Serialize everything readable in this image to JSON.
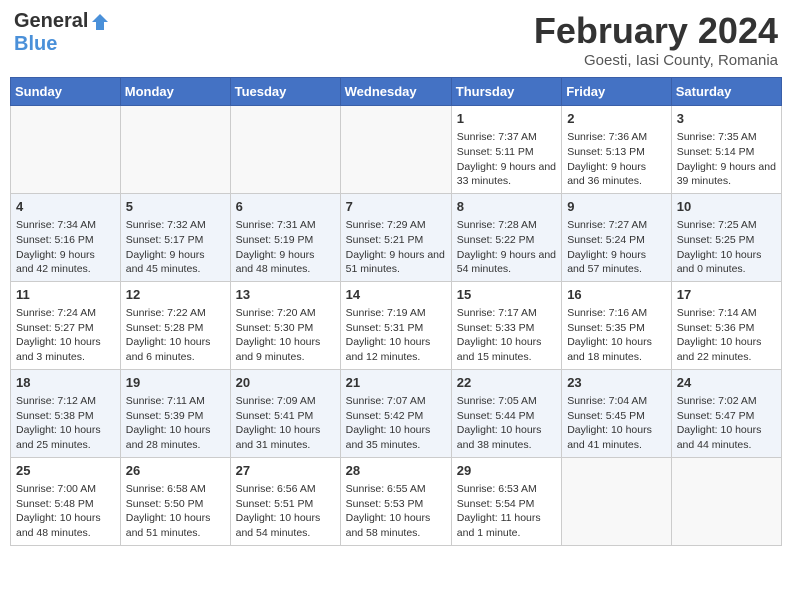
{
  "header": {
    "logo_general": "General",
    "logo_blue": "Blue",
    "month_title": "February 2024",
    "location": "Goesti, Iasi County, Romania"
  },
  "days_of_week": [
    "Sunday",
    "Monday",
    "Tuesday",
    "Wednesday",
    "Thursday",
    "Friday",
    "Saturday"
  ],
  "weeks": [
    {
      "days": [
        {
          "number": "",
          "info": ""
        },
        {
          "number": "",
          "info": ""
        },
        {
          "number": "",
          "info": ""
        },
        {
          "number": "",
          "info": ""
        },
        {
          "number": "1",
          "info": "Sunrise: 7:37 AM\nSunset: 5:11 PM\nDaylight: 9 hours and 33 minutes."
        },
        {
          "number": "2",
          "info": "Sunrise: 7:36 AM\nSunset: 5:13 PM\nDaylight: 9 hours and 36 minutes."
        },
        {
          "number": "3",
          "info": "Sunrise: 7:35 AM\nSunset: 5:14 PM\nDaylight: 9 hours and 39 minutes."
        }
      ]
    },
    {
      "days": [
        {
          "number": "4",
          "info": "Sunrise: 7:34 AM\nSunset: 5:16 PM\nDaylight: 9 hours and 42 minutes."
        },
        {
          "number": "5",
          "info": "Sunrise: 7:32 AM\nSunset: 5:17 PM\nDaylight: 9 hours and 45 minutes."
        },
        {
          "number": "6",
          "info": "Sunrise: 7:31 AM\nSunset: 5:19 PM\nDaylight: 9 hours and 48 minutes."
        },
        {
          "number": "7",
          "info": "Sunrise: 7:29 AM\nSunset: 5:21 PM\nDaylight: 9 hours and 51 minutes."
        },
        {
          "number": "8",
          "info": "Sunrise: 7:28 AM\nSunset: 5:22 PM\nDaylight: 9 hours and 54 minutes."
        },
        {
          "number": "9",
          "info": "Sunrise: 7:27 AM\nSunset: 5:24 PM\nDaylight: 9 hours and 57 minutes."
        },
        {
          "number": "10",
          "info": "Sunrise: 7:25 AM\nSunset: 5:25 PM\nDaylight: 10 hours and 0 minutes."
        }
      ]
    },
    {
      "days": [
        {
          "number": "11",
          "info": "Sunrise: 7:24 AM\nSunset: 5:27 PM\nDaylight: 10 hours and 3 minutes."
        },
        {
          "number": "12",
          "info": "Sunrise: 7:22 AM\nSunset: 5:28 PM\nDaylight: 10 hours and 6 minutes."
        },
        {
          "number": "13",
          "info": "Sunrise: 7:20 AM\nSunset: 5:30 PM\nDaylight: 10 hours and 9 minutes."
        },
        {
          "number": "14",
          "info": "Sunrise: 7:19 AM\nSunset: 5:31 PM\nDaylight: 10 hours and 12 minutes."
        },
        {
          "number": "15",
          "info": "Sunrise: 7:17 AM\nSunset: 5:33 PM\nDaylight: 10 hours and 15 minutes."
        },
        {
          "number": "16",
          "info": "Sunrise: 7:16 AM\nSunset: 5:35 PM\nDaylight: 10 hours and 18 minutes."
        },
        {
          "number": "17",
          "info": "Sunrise: 7:14 AM\nSunset: 5:36 PM\nDaylight: 10 hours and 22 minutes."
        }
      ]
    },
    {
      "days": [
        {
          "number": "18",
          "info": "Sunrise: 7:12 AM\nSunset: 5:38 PM\nDaylight: 10 hours and 25 minutes."
        },
        {
          "number": "19",
          "info": "Sunrise: 7:11 AM\nSunset: 5:39 PM\nDaylight: 10 hours and 28 minutes."
        },
        {
          "number": "20",
          "info": "Sunrise: 7:09 AM\nSunset: 5:41 PM\nDaylight: 10 hours and 31 minutes."
        },
        {
          "number": "21",
          "info": "Sunrise: 7:07 AM\nSunset: 5:42 PM\nDaylight: 10 hours and 35 minutes."
        },
        {
          "number": "22",
          "info": "Sunrise: 7:05 AM\nSunset: 5:44 PM\nDaylight: 10 hours and 38 minutes."
        },
        {
          "number": "23",
          "info": "Sunrise: 7:04 AM\nSunset: 5:45 PM\nDaylight: 10 hours and 41 minutes."
        },
        {
          "number": "24",
          "info": "Sunrise: 7:02 AM\nSunset: 5:47 PM\nDaylight: 10 hours and 44 minutes."
        }
      ]
    },
    {
      "days": [
        {
          "number": "25",
          "info": "Sunrise: 7:00 AM\nSunset: 5:48 PM\nDaylight: 10 hours and 48 minutes."
        },
        {
          "number": "26",
          "info": "Sunrise: 6:58 AM\nSunset: 5:50 PM\nDaylight: 10 hours and 51 minutes."
        },
        {
          "number": "27",
          "info": "Sunrise: 6:56 AM\nSunset: 5:51 PM\nDaylight: 10 hours and 54 minutes."
        },
        {
          "number": "28",
          "info": "Sunrise: 6:55 AM\nSunset: 5:53 PM\nDaylight: 10 hours and 58 minutes."
        },
        {
          "number": "29",
          "info": "Sunrise: 6:53 AM\nSunset: 5:54 PM\nDaylight: 11 hours and 1 minute."
        },
        {
          "number": "",
          "info": ""
        },
        {
          "number": "",
          "info": ""
        }
      ]
    }
  ]
}
